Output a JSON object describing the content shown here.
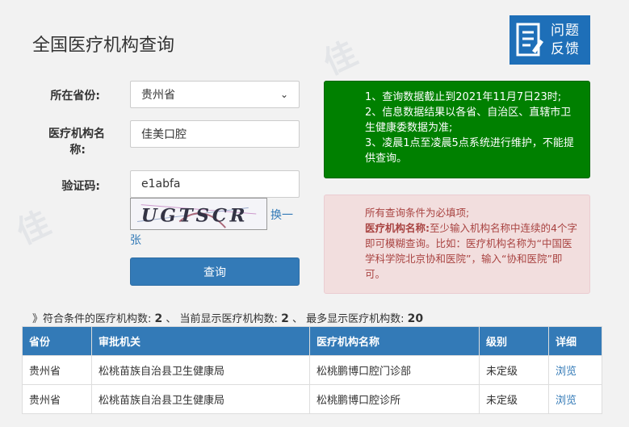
{
  "page": {
    "title": "全国医疗机构查询"
  },
  "feedback": {
    "line1": "问题",
    "line2": "反馈",
    "icon": "document-edit-icon"
  },
  "form": {
    "province_label": "所在省份:",
    "province_value": "贵州省",
    "name_label_line1": "医疗机构名",
    "name_label_line2": "称:",
    "name_value": "佳美口腔",
    "captcha_label": "验证码:",
    "captcha_value": "e1abfa",
    "captcha_image_text": "UGTSCR",
    "refresh_line1": "换一",
    "refresh_line2": "张",
    "submit_label": "查询"
  },
  "notices": {
    "info_lines": [
      "1、查询数据截止到2021年11月7日23时;",
      "2、信息数据结果以各省、自治区、直辖市卫生健康委数据为准;",
      "3、凌晨1点至凌晨5点系统进行维护，不能提供查询。"
    ],
    "warn_line1": "所有查询条件为必填项;",
    "warn_bold": "医疗机构名称:",
    "warn_rest": "至少输入机构名称中连续的4个字即可模糊查询。比如：医疗机构名称为“中国医学科学院北京协和医院”，输入“协和医院”即可。"
  },
  "summary": {
    "prefix": "》符合条件的医疗机构数:",
    "matched": "2",
    "mid1": "、 当前显示医疗机构数:",
    "shown": "2",
    "mid2": "、 最多显示医疗机构数:",
    "max": "20"
  },
  "table": {
    "headers": [
      "省份",
      "审批机关",
      "医疗机构名称",
      "级别",
      "详细"
    ],
    "rows": [
      [
        "贵州省",
        "松桃苗族自治县卫生健康局",
        "松桃鹏博口腔门诊部",
        "未定级",
        "浏览"
      ],
      [
        "贵州省",
        "松桃苗族自治县卫生健康局",
        "松桃鹏博口腔诊所",
        "未定级",
        "浏览"
      ]
    ]
  },
  "colors": {
    "primary": "#337ab7",
    "feedback_bg": "#1e6fb8",
    "info_bg": "#008000",
    "warn_bg": "#f2dede",
    "warn_text": "#a94442"
  }
}
